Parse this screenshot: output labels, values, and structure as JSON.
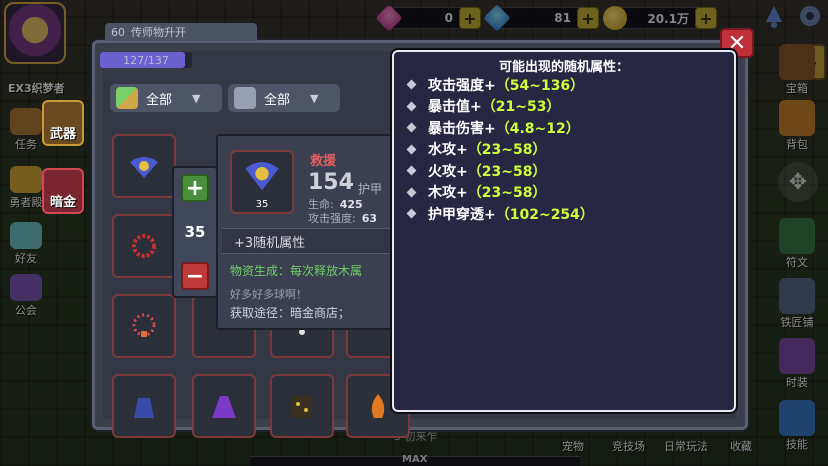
{
  "topbar": {
    "resources": [
      {
        "icon": "pink-gem-icon",
        "value": "0"
      },
      {
        "icon": "blue-diamond-icon",
        "value": "81"
      },
      {
        "icon": "gold-coin-icon",
        "value": "20.1万"
      }
    ]
  },
  "hero": {
    "name": "EX3织梦者"
  },
  "left_menu": [
    {
      "label": "任务",
      "icon": "quest-icon"
    },
    {
      "label": "勇者殿",
      "icon": "hero-hall-icon"
    },
    {
      "label": "好友",
      "icon": "friends-icon"
    },
    {
      "label": "公会",
      "icon": "guild-icon"
    }
  ],
  "side_buttons": {
    "weapon": "武器",
    "dark_gold": "暗金"
  },
  "right_menu": [
    {
      "label": "宝箱",
      "icon": "treasure-chest-icon"
    },
    {
      "label": "背包",
      "icon": "backpack-icon"
    },
    {
      "label": "符文",
      "icon": "rune-icon"
    },
    {
      "label": "铁匠铺",
      "icon": "anvil-icon"
    },
    {
      "label": "时装",
      "icon": "costume-icon"
    },
    {
      "label": "技能",
      "icon": "skill-icon"
    }
  ],
  "bottom_menu": [
    "宠物",
    "竞技场",
    "日常玩法",
    "收藏"
  ],
  "floor_text": "5 初来乍",
  "max_label": "MAX",
  "panel": {
    "top_tab": "传师物升开",
    "top_tab_num": "60",
    "capacity": "127/137",
    "capacity_fraction": 0.927,
    "filter1": "全部",
    "filter2": "全部"
  },
  "quantity": {
    "value": "35"
  },
  "item_detail": {
    "name": "救援",
    "value": "154",
    "value_label": "护甲",
    "stat1_label": "生命:",
    "stat1_value": "425",
    "stat2_label": "攻击强度:",
    "stat2_value": "63",
    "count": "35",
    "random_attrs": "+3随机属性",
    "effect": "物资生成：每次释放木属",
    "flavor": "好多好多球啊！",
    "source": "获取途径：暗金商店；"
  },
  "tooltip": {
    "title": "可能出现的随机属性：",
    "attributes": [
      {
        "name": "攻击强度+",
        "range": "（54~136）"
      },
      {
        "name": "暴击值+",
        "range": "（21~53）"
      },
      {
        "name": "暴击伤害+",
        "range": "（4.8~12）"
      },
      {
        "name": "水攻+",
        "range": "（23~58）"
      },
      {
        "name": "火攻+",
        "range": "（23~58）"
      },
      {
        "name": "木攻+",
        "range": "（23~58）"
      },
      {
        "name": "护甲穿透+",
        "range": "（102~254）"
      }
    ]
  },
  "colors": {
    "tooltip_bg": "#272643",
    "range_highlight": "#cfff3a",
    "effect_green": "#6fd06a",
    "close_red": "#c0303a",
    "item_name_red": "#e06060"
  }
}
